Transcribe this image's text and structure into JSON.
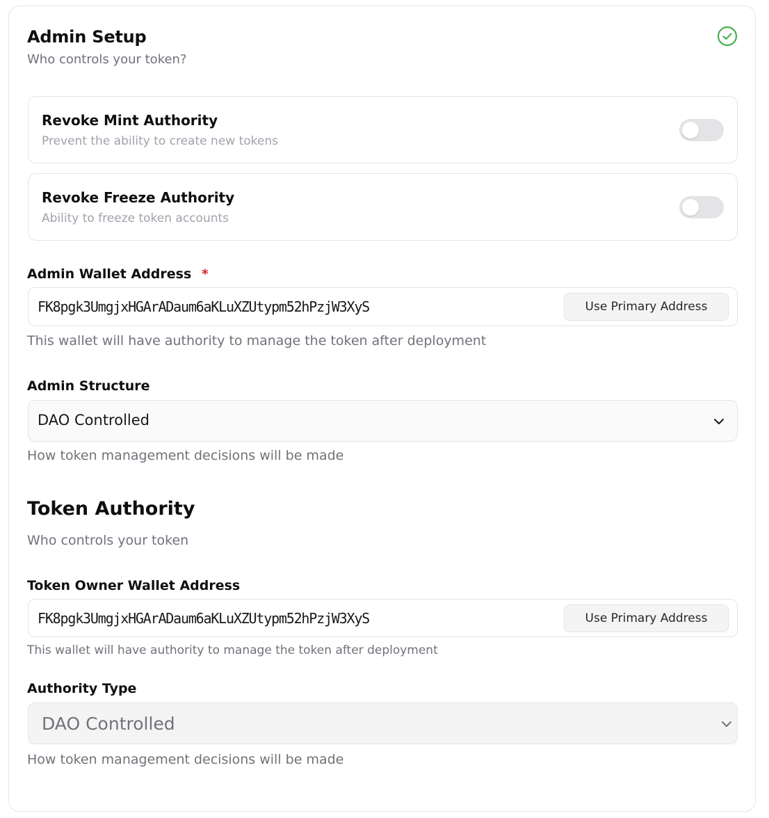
{
  "admin_setup": {
    "title": "Admin Setup",
    "subtitle": "Who controls your token?",
    "status_icon": "check-circle-icon",
    "status_color": "#4caf50"
  },
  "toggles": [
    {
      "title": "Revoke Mint Authority",
      "description": "Prevent the ability to create new tokens",
      "enabled": false
    },
    {
      "title": "Revoke Freeze Authority",
      "description": "Ability to freeze token accounts",
      "enabled": false
    }
  ],
  "admin_wallet": {
    "label": "Admin Wallet Address",
    "required_mark": "*",
    "value": "FK8pgk3UmgjxHGArADaum6aKLuXZUtypm52hPzjW3XyS",
    "button_label": "Use Primary Address",
    "help": "This wallet will have authority to manage the token after deployment"
  },
  "admin_structure": {
    "label": "Admin Structure",
    "selected": "DAO Controlled",
    "help": "How token management decisions will be made"
  },
  "token_authority": {
    "title": "Token Authority",
    "subtitle": "Who controls your token"
  },
  "token_owner_wallet": {
    "label": "Token Owner Wallet Address",
    "value": "FK8pgk3UmgjxHGArADaum6aKLuXZUtypm52hPzjW3XyS",
    "button_label": "Use Primary Address",
    "help": "This wallet will have authority to manage the token after deployment"
  },
  "authority_type": {
    "label": "Authority Type",
    "selected": "DAO Controlled",
    "help": "How token management decisions will be made",
    "disabled": true
  },
  "colors": {
    "required": "#dc2626",
    "border": "#e4e4e7",
    "muted_text": "#71717a"
  }
}
